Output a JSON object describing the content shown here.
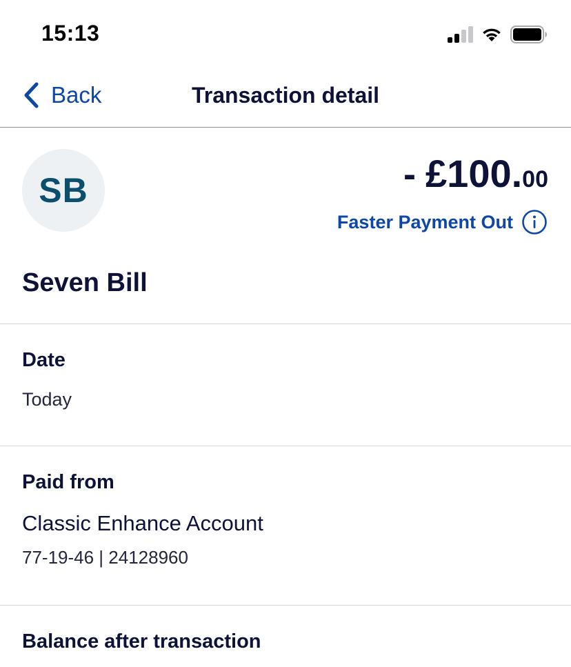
{
  "status_bar": {
    "time": "15:13",
    "icons": [
      "cellular-signal-icon",
      "wifi-icon",
      "battery-icon"
    ]
  },
  "nav": {
    "back_label": "Back",
    "title": "Transaction detail"
  },
  "transaction": {
    "avatar_initials": "SB",
    "amount_sign": "-",
    "amount_major": "£100.",
    "amount_minor": "00",
    "payment_type": "Faster Payment Out",
    "payee_name": "Seven Bill"
  },
  "details": {
    "date_label": "Date",
    "date_value": "Today",
    "paid_from_label": "Paid from",
    "account_name": "Classic Enhance Account",
    "account_numbers": "77-19-46 | 24128960",
    "balance_label": "Balance after transaction"
  },
  "colors": {
    "accent": "#0d47a8",
    "text_primary": "#0f1238",
    "avatar_bg": "#eef1f4",
    "avatar_text": "#0b4f6c",
    "divider": "#d3d4d9"
  }
}
